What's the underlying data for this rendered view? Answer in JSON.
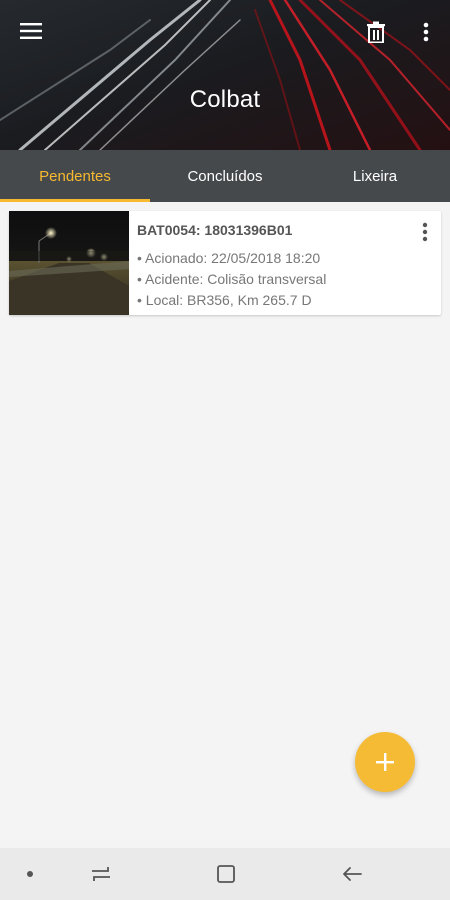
{
  "app": {
    "title": "Colbat"
  },
  "header": {
    "icons": [
      "menu-icon",
      "trash-icon",
      "more-vert-icon"
    ]
  },
  "tabs": [
    {
      "label": "Pendentes",
      "active": true
    },
    {
      "label": "Concluídos",
      "active": false
    },
    {
      "label": "Lixeira",
      "active": false
    }
  ],
  "cards": [
    {
      "title": "BAT0054: 18031396B01",
      "lines": [
        "• Acionado:  22/05/2018 18:20",
        "• Acidente:  Colisão transversal",
        "• Local:  BR356, Km 265.7 D"
      ]
    }
  ],
  "fab": {
    "icon": "plus-icon"
  },
  "navbar": {
    "icons": [
      "dot-icon",
      "recent-apps-icon",
      "home-icon",
      "back-icon"
    ]
  },
  "colors": {
    "accent": "#f6b92f",
    "tabbar": "#46494c",
    "background": "#f4f4f4"
  }
}
